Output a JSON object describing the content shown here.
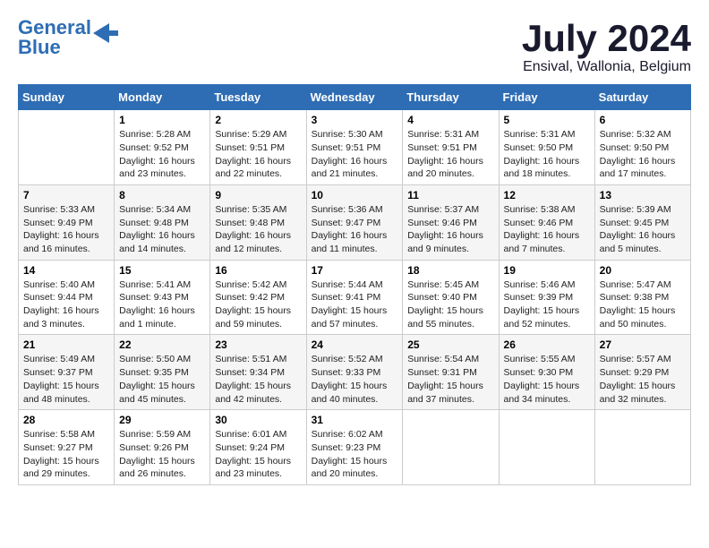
{
  "logo": {
    "line1": "General",
    "line2": "Blue"
  },
  "title": "July 2024",
  "subtitle": "Ensival, Wallonia, Belgium",
  "days_header": [
    "Sunday",
    "Monday",
    "Tuesday",
    "Wednesday",
    "Thursday",
    "Friday",
    "Saturday"
  ],
  "weeks": [
    [
      {
        "num": "",
        "info": ""
      },
      {
        "num": "1",
        "info": "Sunrise: 5:28 AM\nSunset: 9:52 PM\nDaylight: 16 hours\nand 23 minutes."
      },
      {
        "num": "2",
        "info": "Sunrise: 5:29 AM\nSunset: 9:51 PM\nDaylight: 16 hours\nand 22 minutes."
      },
      {
        "num": "3",
        "info": "Sunrise: 5:30 AM\nSunset: 9:51 PM\nDaylight: 16 hours\nand 21 minutes."
      },
      {
        "num": "4",
        "info": "Sunrise: 5:31 AM\nSunset: 9:51 PM\nDaylight: 16 hours\nand 20 minutes."
      },
      {
        "num": "5",
        "info": "Sunrise: 5:31 AM\nSunset: 9:50 PM\nDaylight: 16 hours\nand 18 minutes."
      },
      {
        "num": "6",
        "info": "Sunrise: 5:32 AM\nSunset: 9:50 PM\nDaylight: 16 hours\nand 17 minutes."
      }
    ],
    [
      {
        "num": "7",
        "info": "Sunrise: 5:33 AM\nSunset: 9:49 PM\nDaylight: 16 hours\nand 16 minutes."
      },
      {
        "num": "8",
        "info": "Sunrise: 5:34 AM\nSunset: 9:48 PM\nDaylight: 16 hours\nand 14 minutes."
      },
      {
        "num": "9",
        "info": "Sunrise: 5:35 AM\nSunset: 9:48 PM\nDaylight: 16 hours\nand 12 minutes."
      },
      {
        "num": "10",
        "info": "Sunrise: 5:36 AM\nSunset: 9:47 PM\nDaylight: 16 hours\nand 11 minutes."
      },
      {
        "num": "11",
        "info": "Sunrise: 5:37 AM\nSunset: 9:46 PM\nDaylight: 16 hours\nand 9 minutes."
      },
      {
        "num": "12",
        "info": "Sunrise: 5:38 AM\nSunset: 9:46 PM\nDaylight: 16 hours\nand 7 minutes."
      },
      {
        "num": "13",
        "info": "Sunrise: 5:39 AM\nSunset: 9:45 PM\nDaylight: 16 hours\nand 5 minutes."
      }
    ],
    [
      {
        "num": "14",
        "info": "Sunrise: 5:40 AM\nSunset: 9:44 PM\nDaylight: 16 hours\nand 3 minutes."
      },
      {
        "num": "15",
        "info": "Sunrise: 5:41 AM\nSunset: 9:43 PM\nDaylight: 16 hours\nand 1 minute."
      },
      {
        "num": "16",
        "info": "Sunrise: 5:42 AM\nSunset: 9:42 PM\nDaylight: 15 hours\nand 59 minutes."
      },
      {
        "num": "17",
        "info": "Sunrise: 5:44 AM\nSunset: 9:41 PM\nDaylight: 15 hours\nand 57 minutes."
      },
      {
        "num": "18",
        "info": "Sunrise: 5:45 AM\nSunset: 9:40 PM\nDaylight: 15 hours\nand 55 minutes."
      },
      {
        "num": "19",
        "info": "Sunrise: 5:46 AM\nSunset: 9:39 PM\nDaylight: 15 hours\nand 52 minutes."
      },
      {
        "num": "20",
        "info": "Sunrise: 5:47 AM\nSunset: 9:38 PM\nDaylight: 15 hours\nand 50 minutes."
      }
    ],
    [
      {
        "num": "21",
        "info": "Sunrise: 5:49 AM\nSunset: 9:37 PM\nDaylight: 15 hours\nand 48 minutes."
      },
      {
        "num": "22",
        "info": "Sunrise: 5:50 AM\nSunset: 9:35 PM\nDaylight: 15 hours\nand 45 minutes."
      },
      {
        "num": "23",
        "info": "Sunrise: 5:51 AM\nSunset: 9:34 PM\nDaylight: 15 hours\nand 42 minutes."
      },
      {
        "num": "24",
        "info": "Sunrise: 5:52 AM\nSunset: 9:33 PM\nDaylight: 15 hours\nand 40 minutes."
      },
      {
        "num": "25",
        "info": "Sunrise: 5:54 AM\nSunset: 9:31 PM\nDaylight: 15 hours\nand 37 minutes."
      },
      {
        "num": "26",
        "info": "Sunrise: 5:55 AM\nSunset: 9:30 PM\nDaylight: 15 hours\nand 34 minutes."
      },
      {
        "num": "27",
        "info": "Sunrise: 5:57 AM\nSunset: 9:29 PM\nDaylight: 15 hours\nand 32 minutes."
      }
    ],
    [
      {
        "num": "28",
        "info": "Sunrise: 5:58 AM\nSunset: 9:27 PM\nDaylight: 15 hours\nand 29 minutes."
      },
      {
        "num": "29",
        "info": "Sunrise: 5:59 AM\nSunset: 9:26 PM\nDaylight: 15 hours\nand 26 minutes."
      },
      {
        "num": "30",
        "info": "Sunrise: 6:01 AM\nSunset: 9:24 PM\nDaylight: 15 hours\nand 23 minutes."
      },
      {
        "num": "31",
        "info": "Sunrise: 6:02 AM\nSunset: 9:23 PM\nDaylight: 15 hours\nand 20 minutes."
      },
      {
        "num": "",
        "info": ""
      },
      {
        "num": "",
        "info": ""
      },
      {
        "num": "",
        "info": ""
      }
    ]
  ]
}
